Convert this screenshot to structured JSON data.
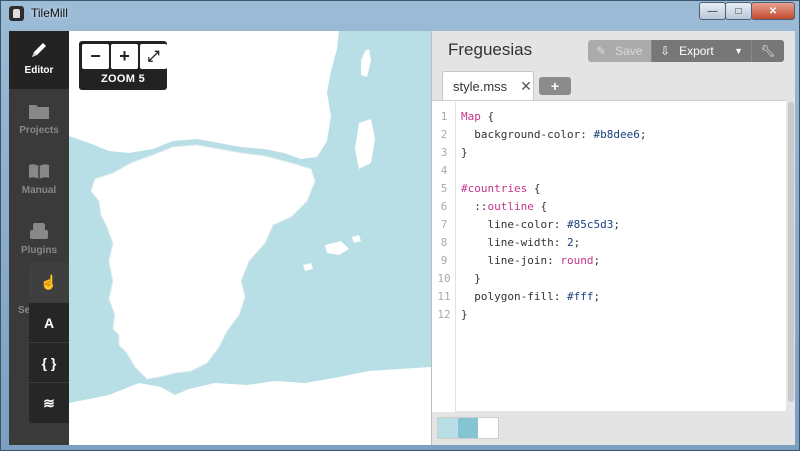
{
  "window": {
    "title": "TileMill",
    "minimize": "—",
    "maximize": "□",
    "close": "✕"
  },
  "nav": {
    "items": [
      {
        "label": "Editor",
        "icon": "pencil-icon"
      },
      {
        "label": "Projects",
        "icon": "folder-icon"
      },
      {
        "label": "Manual",
        "icon": "book-icon"
      },
      {
        "label": "Plugins",
        "icon": "plugin-icon"
      }
    ],
    "settings_partial": "Se"
  },
  "map_tools": {
    "pointer": "☝",
    "text": "A",
    "braces": "{ }",
    "layers": "≋"
  },
  "zoom": {
    "minus": "−",
    "plus": "+",
    "fullscreen": "⤢",
    "label": "ZOOM 5"
  },
  "editor": {
    "project_title": "Freguesias",
    "save_label": "Save",
    "export_label": "Export",
    "tab_name": "style.mss",
    "tab_close": "✕",
    "add_tab": "+",
    "code": [
      {
        "n": "1",
        "parts": [
          {
            "t": "Map",
            "c": "kw"
          },
          {
            "t": " {",
            "c": "prop"
          }
        ]
      },
      {
        "n": "2",
        "parts": [
          {
            "t": "  background-color: ",
            "c": "prop"
          },
          {
            "t": "#b8dee6",
            "c": "val"
          },
          {
            "t": ";",
            "c": "prop"
          }
        ]
      },
      {
        "n": "3",
        "parts": [
          {
            "t": "}",
            "c": "prop"
          }
        ]
      },
      {
        "n": "4",
        "parts": []
      },
      {
        "n": "5",
        "parts": [
          {
            "t": "#countries",
            "c": "kw"
          },
          {
            "t": " {",
            "c": "prop"
          }
        ]
      },
      {
        "n": "6",
        "parts": [
          {
            "t": "  ::",
            "c": "prop"
          },
          {
            "t": "outline",
            "c": "kw"
          },
          {
            "t": " {",
            "c": "prop"
          }
        ]
      },
      {
        "n": "7",
        "parts": [
          {
            "t": "    line-color: ",
            "c": "prop"
          },
          {
            "t": "#85c5d3",
            "c": "val"
          },
          {
            "t": ";",
            "c": "prop"
          }
        ]
      },
      {
        "n": "8",
        "parts": [
          {
            "t": "    line-width: ",
            "c": "prop"
          },
          {
            "t": "2",
            "c": "val"
          },
          {
            "t": ";",
            "c": "prop"
          }
        ]
      },
      {
        "n": "9",
        "parts": [
          {
            "t": "    line-join: ",
            "c": "prop"
          },
          {
            "t": "round",
            "c": "kw"
          },
          {
            "t": ";",
            "c": "prop"
          }
        ]
      },
      {
        "n": "10",
        "parts": [
          {
            "t": "  }",
            "c": "prop"
          }
        ]
      },
      {
        "n": "11",
        "parts": [
          {
            "t": "  polygon-fill: ",
            "c": "prop"
          },
          {
            "t": "#fff",
            "c": "val"
          },
          {
            "t": ";",
            "c": "prop"
          }
        ]
      },
      {
        "n": "12",
        "parts": [
          {
            "t": "}",
            "c": "prop"
          }
        ]
      }
    ],
    "swatches": [
      "#b8dee6",
      "#85c5d3",
      "#ffffff"
    ]
  },
  "colors": {
    "map_water": "#b8dee6",
    "land": "#ffffff",
    "nav_bg": "#3a3a3a"
  }
}
